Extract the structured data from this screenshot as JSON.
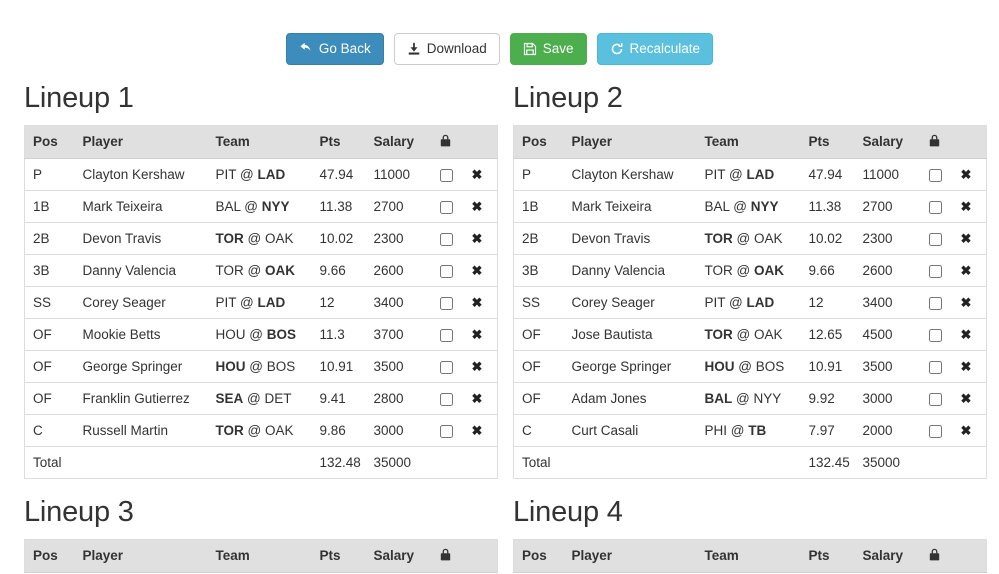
{
  "toolbar": {
    "buttons": [
      {
        "label": "Go Back",
        "icon": "undo-arrow-icon",
        "style": "primary"
      },
      {
        "label": "Download",
        "icon": "download-icon",
        "style": "default"
      },
      {
        "label": "Save",
        "icon": "floppy-disk-icon",
        "style": "success"
      },
      {
        "label": "Recalculate",
        "icon": "refresh-icon",
        "style": "info"
      }
    ],
    "colors": {
      "primary": "#3c8dbc",
      "default": "#ffffff",
      "success": "#4cae4c",
      "info": "#5bc0de"
    }
  },
  "table": {
    "columns": [
      "Pos",
      "Player",
      "Team",
      "Pts",
      "Salary"
    ],
    "lock_header_icon": "lock-icon",
    "total_label": "Total",
    "delete_icon": "delete-x-icon",
    "lock_checkbox": "lock-checkbox",
    "header_background": "#e0e0e0"
  },
  "lineups": [
    {
      "title": "Lineup 1",
      "rows": [
        {
          "pos": "P",
          "player": "Clayton Kershaw",
          "away": "PIT",
          "home": "LAD",
          "home_is_bold": true,
          "pts": "47.94",
          "salary": "11000"
        },
        {
          "pos": "1B",
          "player": "Mark Teixeira",
          "away": "BAL",
          "home": "NYY",
          "home_is_bold": true,
          "pts": "11.38",
          "salary": "2700"
        },
        {
          "pos": "2B",
          "player": "Devon Travis",
          "away": "TOR",
          "home": "OAK",
          "home_is_bold": false,
          "pts": "10.02",
          "salary": "2300"
        },
        {
          "pos": "3B",
          "player": "Danny Valencia",
          "away": "TOR",
          "home": "OAK",
          "home_is_bold": true,
          "pts": "9.66",
          "salary": "2600"
        },
        {
          "pos": "SS",
          "player": "Corey Seager",
          "away": "PIT",
          "home": "LAD",
          "home_is_bold": true,
          "pts": "12",
          "salary": "3400"
        },
        {
          "pos": "OF",
          "player": "Mookie Betts",
          "away": "HOU",
          "home": "BOS",
          "home_is_bold": true,
          "pts": "11.3",
          "salary": "3700"
        },
        {
          "pos": "OF",
          "player": "George Springer",
          "away": "HOU",
          "home": "BOS",
          "home_is_bold": false,
          "pts": "10.91",
          "salary": "3500"
        },
        {
          "pos": "OF",
          "player": "Franklin Gutierrez",
          "away": "SEA",
          "home": "DET",
          "home_is_bold": false,
          "pts": "9.41",
          "salary": "2800"
        },
        {
          "pos": "C",
          "player": "Russell Martin",
          "away": "TOR",
          "home": "OAK",
          "home_is_bold": false,
          "pts": "9.86",
          "salary": "3000"
        }
      ],
      "total_pts": "132.48",
      "total_salary": "35000"
    },
    {
      "title": "Lineup 2",
      "rows": [
        {
          "pos": "P",
          "player": "Clayton Kershaw",
          "away": "PIT",
          "home": "LAD",
          "home_is_bold": true,
          "pts": "47.94",
          "salary": "11000"
        },
        {
          "pos": "1B",
          "player": "Mark Teixeira",
          "away": "BAL",
          "home": "NYY",
          "home_is_bold": true,
          "pts": "11.38",
          "salary": "2700"
        },
        {
          "pos": "2B",
          "player": "Devon Travis",
          "away": "TOR",
          "home": "OAK",
          "home_is_bold": false,
          "pts": "10.02",
          "salary": "2300"
        },
        {
          "pos": "3B",
          "player": "Danny Valencia",
          "away": "TOR",
          "home": "OAK",
          "home_is_bold": true,
          "pts": "9.66",
          "salary": "2600"
        },
        {
          "pos": "SS",
          "player": "Corey Seager",
          "away": "PIT",
          "home": "LAD",
          "home_is_bold": true,
          "pts": "12",
          "salary": "3400"
        },
        {
          "pos": "OF",
          "player": "Jose Bautista",
          "away": "TOR",
          "home": "OAK",
          "home_is_bold": false,
          "pts": "12.65",
          "salary": "4500"
        },
        {
          "pos": "OF",
          "player": "George Springer",
          "away": "HOU",
          "home": "BOS",
          "home_is_bold": false,
          "pts": "10.91",
          "salary": "3500"
        },
        {
          "pos": "OF",
          "player": "Adam Jones",
          "away": "BAL",
          "home": "NYY",
          "home_is_bold": false,
          "pts": "9.92",
          "salary": "3000"
        },
        {
          "pos": "C",
          "player": "Curt Casali",
          "away": "PHI",
          "home": "TB",
          "home_is_bold": true,
          "pts": "7.97",
          "salary": "2000"
        }
      ],
      "total_pts": "132.45",
      "total_salary": "35000"
    },
    {
      "title": "Lineup 3",
      "rows": [],
      "total_pts": "",
      "total_salary": ""
    },
    {
      "title": "Lineup 4",
      "rows": [],
      "total_pts": "",
      "total_salary": ""
    }
  ]
}
